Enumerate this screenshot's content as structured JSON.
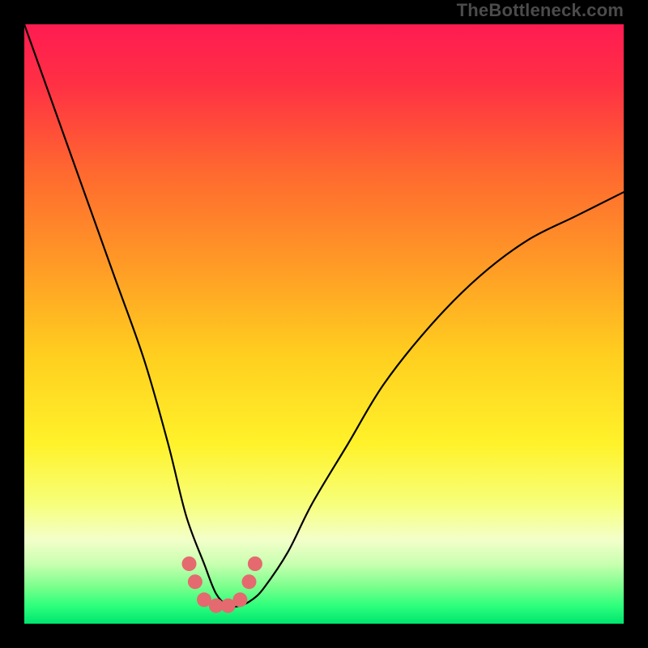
{
  "watermark": "TheBottleneck.com",
  "chart_data": {
    "type": "line",
    "title": "",
    "xlabel": "",
    "ylabel": "",
    "xlim": [
      0,
      100
    ],
    "ylim": [
      0,
      100
    ],
    "grid": false,
    "series": [
      {
        "name": "bottleneck-curve",
        "x": [
          0,
          5,
          10,
          15,
          20,
          24,
          27,
          30,
          32,
          34,
          36,
          38,
          40,
          44,
          48,
          54,
          60,
          68,
          76,
          84,
          92,
          100
        ],
        "y": [
          100,
          86,
          72,
          58,
          44,
          30,
          18,
          10,
          5,
          3,
          3,
          4,
          6,
          12,
          20,
          30,
          40,
          50,
          58,
          64,
          68,
          72
        ]
      }
    ],
    "markers": {
      "name": "trough-dots",
      "x": [
        27.5,
        28.5,
        30,
        32,
        34,
        36,
        37.5,
        38.5
      ],
      "y": [
        10,
        7,
        4,
        3,
        3,
        4,
        7,
        10
      ],
      "size_pairs": [
        [
          0,
          1
        ],
        [
          2,
          3
        ],
        [
          4,
          5
        ],
        [
          6,
          7
        ]
      ]
    },
    "background_gradient_stops": [
      {
        "pos": 0.0,
        "color": "#ff1b52"
      },
      {
        "pos": 0.1,
        "color": "#ff3044"
      },
      {
        "pos": 0.25,
        "color": "#ff6a2f"
      },
      {
        "pos": 0.4,
        "color": "#ff9a26"
      },
      {
        "pos": 0.55,
        "color": "#ffce1f"
      },
      {
        "pos": 0.7,
        "color": "#fff22a"
      },
      {
        "pos": 0.8,
        "color": "#f7ff7a"
      },
      {
        "pos": 0.86,
        "color": "#f3ffca"
      },
      {
        "pos": 0.9,
        "color": "#c9ffb0"
      },
      {
        "pos": 0.94,
        "color": "#77ff8b"
      },
      {
        "pos": 0.97,
        "color": "#2dff7c"
      },
      {
        "pos": 1.0,
        "color": "#00e56f"
      }
    ]
  }
}
